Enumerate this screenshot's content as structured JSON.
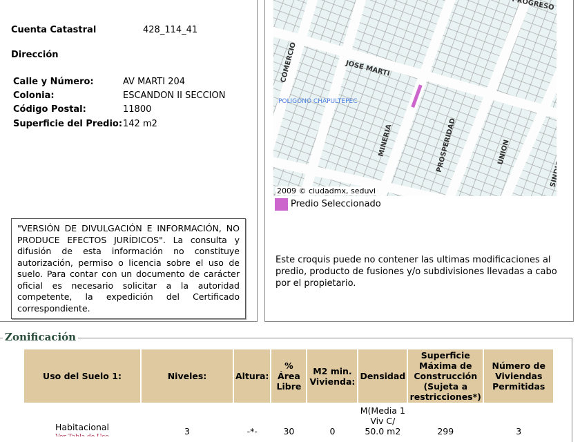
{
  "predio": {
    "cuenta_label": "Cuenta Catastral",
    "cuenta_value": "428_114_41",
    "direccion_label": "Dirección",
    "fields": [
      {
        "label": "Calle y Número:",
        "value": "AV MARTI 204"
      },
      {
        "label": "Colonia:",
        "value": "ESCANDON II SECCION"
      },
      {
        "label": "Código Postal:",
        "value": "11800"
      },
      {
        "label": "Superficie del Predio:",
        "value": "142 m2"
      }
    ],
    "disclaimer": "\"VERSIÓN DE DIVULGACIÓN E INFORMACIÓN, NO PRODUCE EFECTOS JURÍDICOS\". La consulta y difusión de esta información no constituye autorización, permiso o licencia sobre el uso de suelo. Para contar con un documento de carácter oficial es necesario solicitar a la autoridad competente, la expedición del Certificado correspondiente."
  },
  "map": {
    "streets": [
      "PROGRESO",
      "COMERCIO",
      "JOSE MARTI",
      "MINERIA",
      "PROSPERIDAD",
      "UNION",
      "SINDICAL"
    ],
    "area_label": "POLIGONO CHAPULTEPEC",
    "copyright": "2009 © ciudadmx, seduvi",
    "legend": "Predio Seleccionado",
    "selected_color": "#cc66cc",
    "note": "Este croquis puede no contener las ultimas modificaciones al predio, producto de fusiones y/o subdivisiones llevadas a cabo por el propietario."
  },
  "zonificacion": {
    "title": "Zonificación",
    "headers": [
      "Uso del Suelo 1:",
      "Niveles:",
      "Altura:",
      "% Área Libre",
      "M2 min. Vivienda:",
      "Densidad",
      "Superficie Máxima de Construcción (Sujeta a restricciones*)",
      "Número de Viviendas Permitidas"
    ],
    "row": {
      "uso": "Habitacional",
      "uso_link": "Ver Tabla de Uso",
      "niveles": "3",
      "altura": "-*-",
      "area_libre": "30",
      "m2_min": "0",
      "densidad": "M(Media 1 Viv C/ 50.0 m2",
      "superficie": "299",
      "viviendas": "3"
    }
  }
}
